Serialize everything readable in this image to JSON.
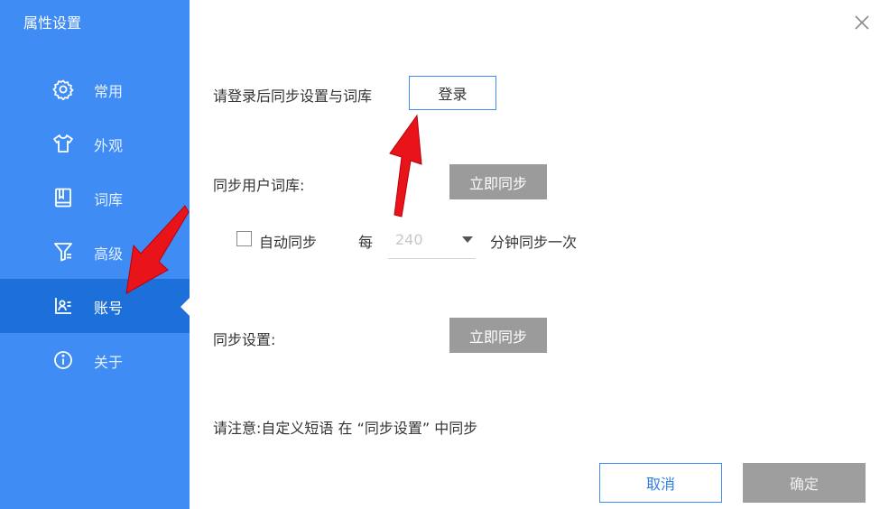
{
  "window": {
    "title": "属性设置"
  },
  "sidebar": {
    "items": [
      {
        "label": "常用",
        "icon": "gear-icon"
      },
      {
        "label": "外观",
        "icon": "shirt-icon"
      },
      {
        "label": "词库",
        "icon": "book-icon"
      },
      {
        "label": "高级",
        "icon": "filter-icon"
      },
      {
        "label": "账号",
        "icon": "account-card-icon",
        "active": true
      },
      {
        "label": "关于",
        "icon": "info-icon"
      }
    ]
  },
  "main": {
    "login_prompt": "请登录后同步设置与词库",
    "login_button": "登录",
    "sync_dict_label": "同步用户词库:",
    "sync_dict_button": "立即同步",
    "auto_sync": {
      "label": "自动同步",
      "checked": false,
      "every_label": "每",
      "interval_value": "240",
      "suffix": "分钟同步一次"
    },
    "sync_settings_label": "同步设置:",
    "sync_settings_button": "立即同步",
    "note": "请注意:自定义短语 在 “同步设置” 中同步"
  },
  "footer": {
    "cancel_label": "取消",
    "confirm_label": "确定"
  },
  "colors": {
    "sidebar": "#3f8cf5",
    "sidebar_active": "#1d70da",
    "button_border": "#3f8cf5",
    "disabled_button": "#9b9b9b",
    "annotation_arrow": "#e8141a"
  }
}
